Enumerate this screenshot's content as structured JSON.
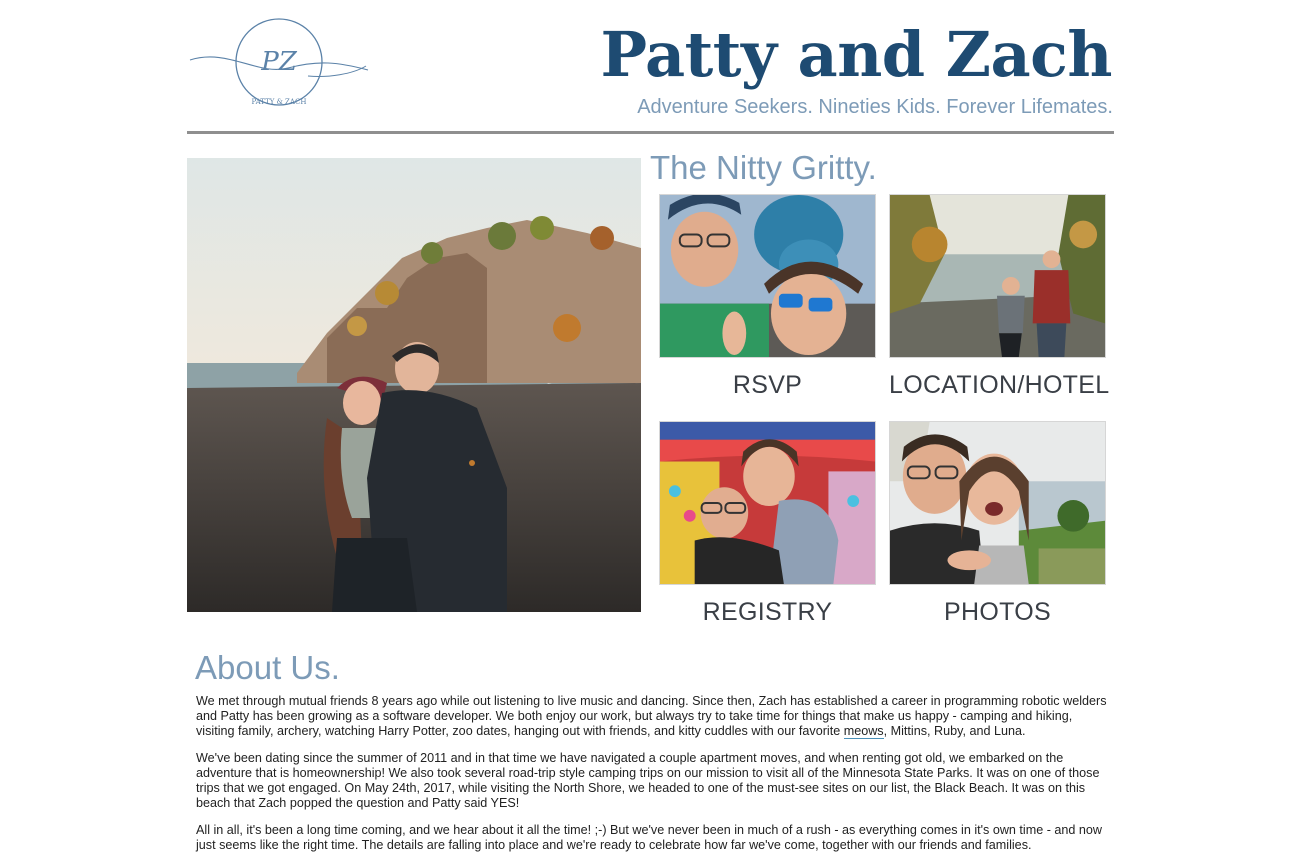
{
  "header": {
    "logo_text": "PZ",
    "logo_caption": "PATTY & ZACH",
    "title": "Patty and Zach",
    "tagline": "Adventure Seekers. Nineties Kids. Forever Lifemates."
  },
  "nitty_gritty": {
    "heading": "The Nitty Gritty.",
    "tiles": [
      {
        "label": "RSVP"
      },
      {
        "label": "LOCATION/HOTEL"
      },
      {
        "label": "REGISTRY"
      },
      {
        "label": "PHOTOS"
      }
    ]
  },
  "about": {
    "heading": "About Us.",
    "p1_before": "We met through mutual friends 8 years ago while out listening to live music and dancing. Since then, Zach has established a career in programming robotic welders and Patty has been growing as a software developer. We both enjoy our work, but always try to take time for things that make us happy - camping and hiking, visiting family, archery, watching Harry Potter, zoo dates, hanging out with friends, and kitty cuddles with our favorite ",
    "p1_link": "meows",
    "p1_after": ", Mittins, Ruby, and Luna.",
    "p2": "We've been dating since the summer of 2011 and in that time we have navigated a couple apartment moves, and when renting got old, we embarked on the adventure that is homeownership! We also took several road-trip style camping trips on our mission to visit all of the Minnesota State Parks. It was on one of those trips that we got engaged. On May 24th, 2017, while visiting the North Shore, we headed to one of the must-see sites on our list, the Black Beach. It was on this beach that Zach popped the question and Patty said YES!",
    "p3": "All in all, it's been a long time coming, and we hear about it all the time! ;-) But we've never been in much of a rush - as everything comes in it's own time - and now just seems like the right time. The details are falling into place and we're ready to celebrate how far we've come, together with our friends and families."
  },
  "colors": {
    "title": "#1e4b72",
    "accent": "#7d9bb7",
    "rule": "#8f8f8f",
    "tile_label": "#3a3f46"
  }
}
